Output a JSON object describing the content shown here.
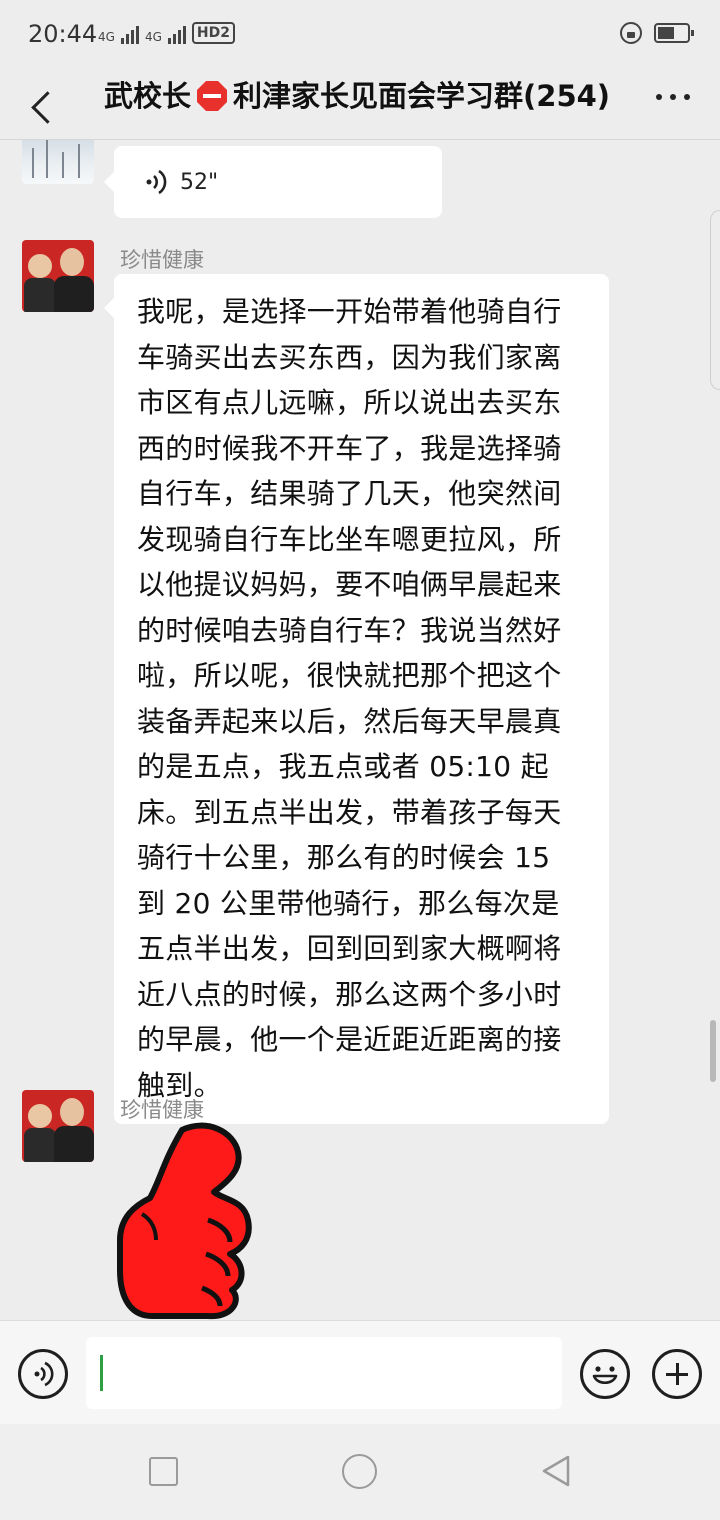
{
  "status_bar": {
    "time": "20:44",
    "network_1": "4G",
    "network_2": "4G",
    "hd_badge": "HD2"
  },
  "header": {
    "title_prefix": "武校长",
    "title_suffix": "利津家长见面会学习群(254)"
  },
  "messages": [
    {
      "type": "voice",
      "duration": "52\""
    },
    {
      "type": "text",
      "sender": "珍惜健康",
      "text": "我呢，是选择一开始带着他骑自行车骑买出去买东西，因为我们家离市区有点儿远嘛，所以说出去买东西的时候我不开车了，我是选择骑自行车，结果骑了几天，他突然间发现骑自行车比坐车嗯更拉风，所以他提议妈妈，要不咱俩早晨起来的时候咱去骑自行车？我说当然好啦，所以呢，很快就把那个把这个装备弄起来以后，然后每天早晨真的是五点，我五点或者 05:10 起床。到五点半出发，带着孩子每天骑行十公里，那么有的时候会 15 到 20 公里带他骑行，那么每次是五点半出发，回到回到家大概啊将近八点的时候，那么这两个多小时的早晨，他一个是近距近距离的接触到。"
    },
    {
      "type": "sticker",
      "sender": "珍惜健康",
      "sticker": "thumbs-up"
    }
  ],
  "input": {
    "placeholder": ""
  },
  "colors": {
    "background": "#ededed",
    "bubble": "#ffffff",
    "caret": "#2ea043",
    "sticker_red": "#ff1a1a"
  }
}
